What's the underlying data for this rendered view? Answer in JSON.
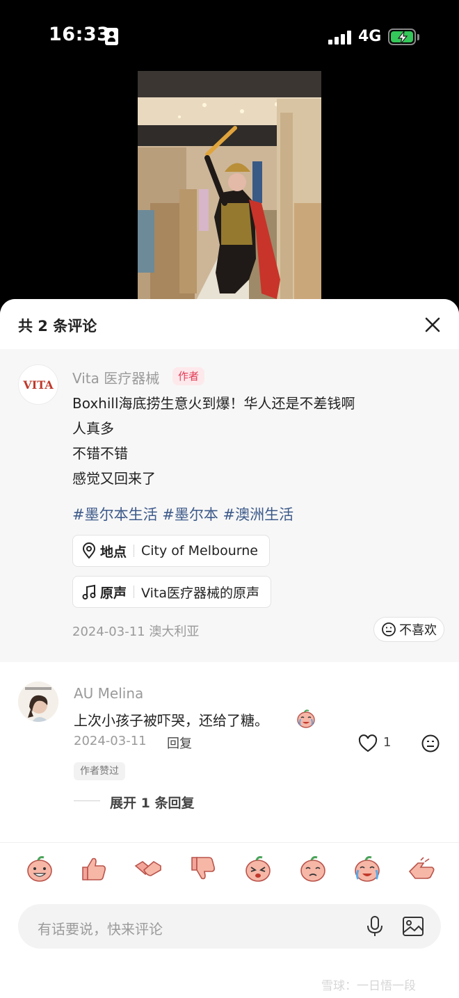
{
  "status_bar": {
    "time": "16:33",
    "network": "4G",
    "signal_bars": 4,
    "battery_charging": true
  },
  "sheet": {
    "title": "共 2 条评论",
    "post": {
      "author": "Vita 医疗器械",
      "author_avatar_text": "VITA",
      "author_tag": "作者",
      "lines": [
        "Boxhill海底捞生意火到爆！华人还是不差钱啊",
        "人真多",
        "不错不错",
        "感觉又回来了"
      ],
      "hashtags": "#墨尔本生活 #墨尔本 #澳洲生活",
      "location_chip": {
        "label": "地点",
        "value": "City of Melbourne"
      },
      "sound_chip": {
        "label": "原声",
        "value": "Vita医疗器械的原声"
      },
      "meta": "2024-03-11 澳大利亚",
      "dislike_label": "不喜欢"
    },
    "comment": {
      "author": "AU Melina",
      "text": "上次小孩子被吓哭，还给了糖。",
      "date": "2024-03-11",
      "reply_label": "回复",
      "like_count": "1",
      "author_liked_badge": "作者赞过",
      "expand_replies": "展开 1 条回复"
    },
    "emoji_bar": [
      "peach-grin-icon",
      "thumbs-up-icon",
      "handshake-icon",
      "thumbs-down-icon",
      "peach-wink-icon",
      "peach-pout-icon",
      "peach-cry-icon",
      "clap-icon"
    ],
    "input": {
      "placeholder": "有话要说，快来评论"
    },
    "watermark": "雪球：一日悟一段"
  },
  "colors": {
    "accent_tag": "#e13b55",
    "hashtag": "#3d5a8a",
    "battery": "#34c759"
  }
}
